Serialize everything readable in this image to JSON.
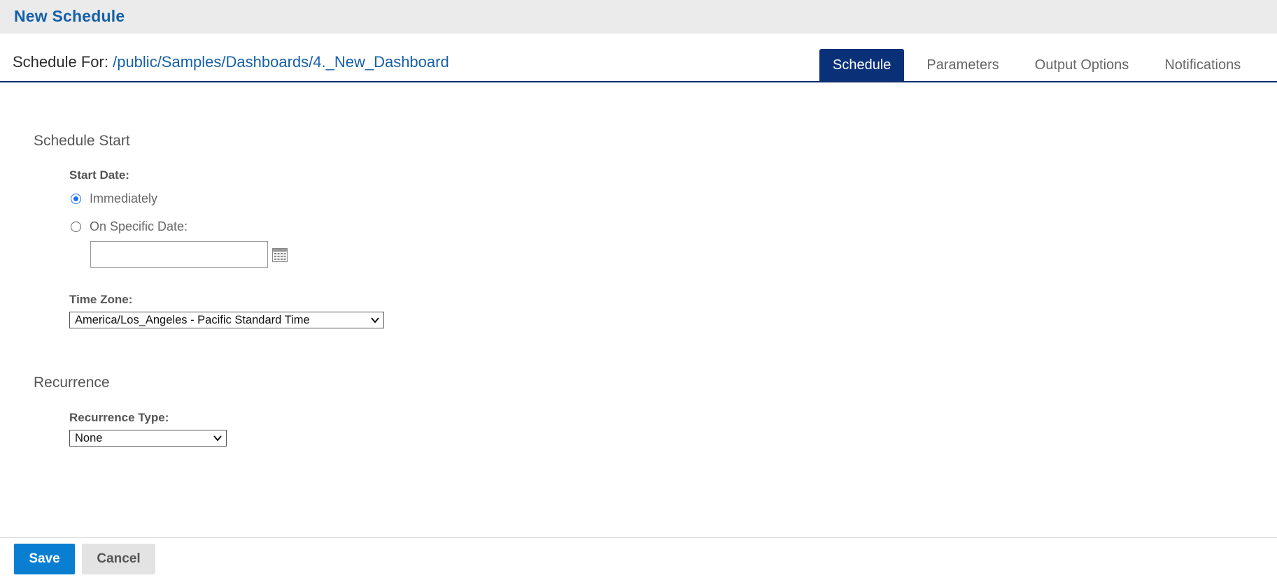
{
  "window": {
    "title": "New Schedule"
  },
  "header": {
    "schedule_for_label": "Schedule For:",
    "path": "/public/Samples/Dashboards/4._New_Dashboard"
  },
  "tabs": [
    {
      "label": "Schedule",
      "active": true
    },
    {
      "label": "Parameters",
      "active": false
    },
    {
      "label": "Output Options",
      "active": false
    },
    {
      "label": "Notifications",
      "active": false
    }
  ],
  "schedule_start": {
    "section_title": "Schedule Start",
    "start_date_label": "Start Date:",
    "option_immediately": "Immediately",
    "option_specific": "On Specific Date:",
    "selected_option": "Immediately",
    "date_value": "",
    "calendar_icon": "calendar-icon",
    "time_zone_label": "Time Zone:",
    "time_zone_value": "America/Los_Angeles - Pacific Standard Time"
  },
  "recurrence": {
    "section_title": "Recurrence",
    "type_label": "Recurrence Type:",
    "type_value": "None"
  },
  "footer": {
    "save_label": "Save",
    "cancel_label": "Cancel"
  },
  "colors": {
    "title_blue": "#1560a8",
    "tab_active_bg": "#0a3178",
    "save_button_bg": "#0a7fd1",
    "radio_checked": "#1a73e8"
  }
}
